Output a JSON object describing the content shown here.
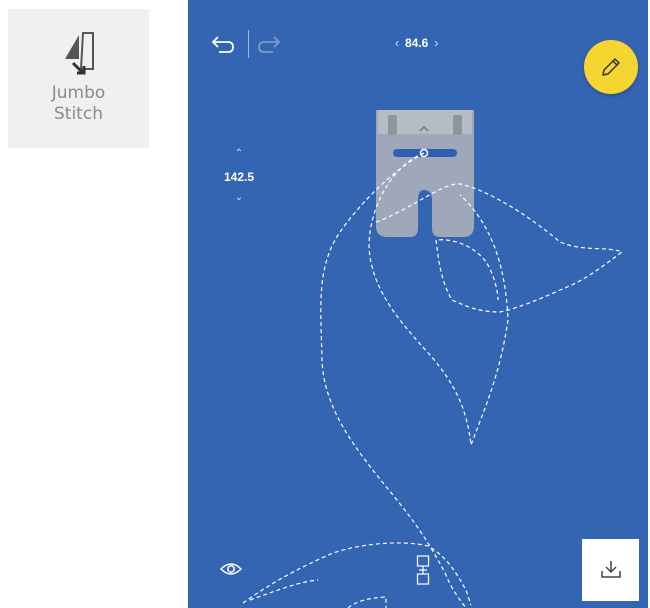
{
  "side_tile": {
    "label": "Jumbo\nStitch",
    "icon": "jumbo-stitch-icon"
  },
  "toolbar": {
    "undo_icon": "undo-arrow-icon",
    "redo_icon": "redo-arrow-icon",
    "horizontal_value": "84.6",
    "horizontal_left_arrow": "‹",
    "horizontal_right_arrow": "›",
    "vertical_value": "142.5",
    "vertical_up_arrow": "⌃",
    "vertical_down_arrow": "⌄",
    "edit_icon": "pencil-icon"
  },
  "bottom": {
    "preview_icon": "eye-icon",
    "move_icon": "move-stitch-icon",
    "download_icon": "download-icon"
  },
  "colors": {
    "canvas_background": "#3465b3",
    "edit_button": "#f7d531",
    "stitch_line": "#ffffff"
  }
}
